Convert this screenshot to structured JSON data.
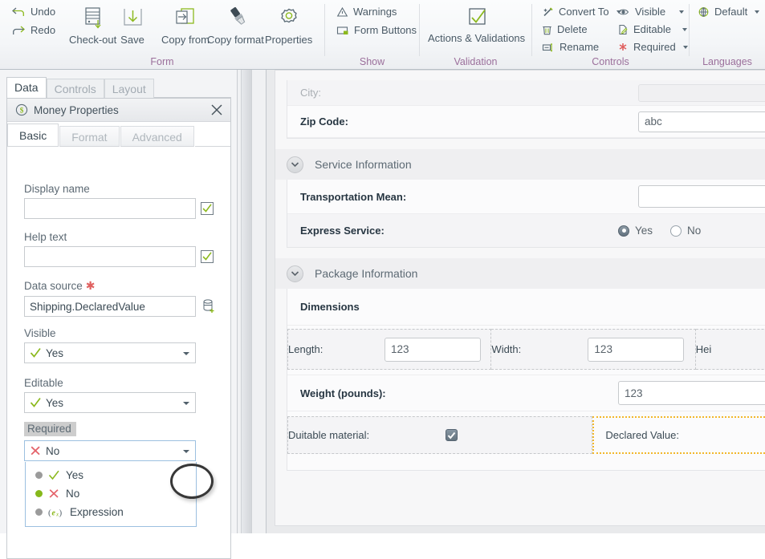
{
  "ribbon": {
    "groups": [
      {
        "name": "Form",
        "label": "Form"
      },
      {
        "name": "Show",
        "label": "Show"
      },
      {
        "name": "Validation",
        "label": "Validation"
      },
      {
        "name": "Controls",
        "label": "Controls"
      },
      {
        "name": "Languages",
        "label": "Languages"
      }
    ],
    "undo": "Undo",
    "redo": "Redo",
    "checkout": "Check-out",
    "save": "Save",
    "copy_from": "Copy from",
    "copy_format": "Copy format",
    "properties": "Properties",
    "warnings": "Warnings",
    "form_buttons": "Form Buttons",
    "actions_validations": "Actions & Validations",
    "convert_to": "Convert To",
    "delete": "Delete",
    "rename": "Rename",
    "visible": "Visible",
    "editable": "Editable",
    "required": "Required",
    "default_language": "Default",
    "group_label_color": "#9b6f9b"
  },
  "left_panel": {
    "tabs": [
      {
        "label": "Data",
        "active": true
      },
      {
        "label": "Controls",
        "active": false
      },
      {
        "label": "Layout",
        "active": false
      }
    ],
    "dialog": {
      "title": "Money Properties",
      "icon": "money-icon",
      "close_label": "×",
      "tabs": [
        {
          "label": "Basic",
          "active": true
        },
        {
          "label": "Format",
          "active": false
        },
        {
          "label": "Advanced",
          "active": false
        }
      ],
      "fields": {
        "display_name": {
          "label": "Display name",
          "value": "",
          "checkbox": true
        },
        "help_text": {
          "label": "Help text",
          "value": "",
          "checkbox": true
        },
        "data_source": {
          "label": "Data source",
          "value": "Shipping.DeclaredValue",
          "required_marker": "✱"
        },
        "visible": {
          "label": "Visible",
          "value": "Yes",
          "icon": "check-icon"
        },
        "editable": {
          "label": "Editable",
          "value": "Yes",
          "icon": "check-icon"
        },
        "required": {
          "label": "Required",
          "value": "No",
          "icon": "cross-icon",
          "highlighted": true,
          "open": true,
          "options": [
            {
              "label": "Yes",
              "icon": "check-icon",
              "selected": false
            },
            {
              "label": "No",
              "icon": "cross-icon",
              "selected": true
            },
            {
              "label": "Expression",
              "icon": "expression-icon",
              "selected": false
            }
          ]
        }
      }
    }
  },
  "form_canvas": {
    "rows_top": [
      {
        "label": "City:",
        "muted": true,
        "control": "text",
        "value": "",
        "ghost": true
      },
      {
        "label": "Zip Code:",
        "muted": false,
        "control": "text",
        "value": "abc",
        "ghost": false
      }
    ],
    "sections": [
      {
        "title": "Service Information",
        "rows": [
          {
            "label": "Transportation Mean:",
            "control": "text",
            "value": ""
          },
          {
            "label": "Express Service:",
            "control": "radio",
            "options": [
              {
                "label": "Yes",
                "selected": true
              },
              {
                "label": "No",
                "selected": false
              }
            ]
          }
        ]
      },
      {
        "title": "Package Information",
        "subheader": "Dimensions",
        "rows": [
          {
            "label": "Length:",
            "control": "text",
            "value": "123"
          },
          {
            "label": "Width:",
            "control": "text",
            "value": "123"
          },
          {
            "label": "Hei",
            "control": "text",
            "value": ""
          },
          {
            "label": "Weight (pounds):",
            "control": "text",
            "value": "123"
          },
          {
            "label": "Duitable material:",
            "control": "checkbox",
            "checked": true
          },
          {
            "label": "Declared Value:",
            "control": "text",
            "value": "",
            "selected": true
          }
        ]
      }
    ]
  },
  "colors": {
    "accent_green": "#8cb91e",
    "ribbon_label": "#9b6f9b",
    "selection_orange": "#f2b72b",
    "required_red": "#e0605f",
    "text": "#3b4a54"
  }
}
